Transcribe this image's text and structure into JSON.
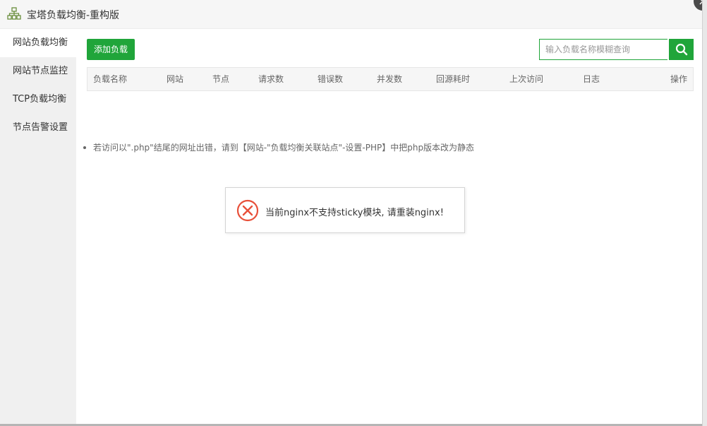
{
  "window": {
    "title": "宝塔负载均衡-重构版",
    "close_symbol": "×"
  },
  "sidebar": {
    "items": [
      {
        "label": "网站负载均衡",
        "active": true
      },
      {
        "label": "网站节点监控",
        "active": false
      },
      {
        "label": "TCP负载均衡",
        "active": false
      },
      {
        "label": "节点告警设置",
        "active": false
      }
    ]
  },
  "toolbar": {
    "add_label": "添加负载",
    "search_placeholder": "输入负载名称模糊查询"
  },
  "table": {
    "columns": [
      "负载名称",
      "网站",
      "节点",
      "请求数",
      "错误数",
      "并发数",
      "回源耗时",
      "上次访问",
      "日志",
      "操作"
    ],
    "rows": []
  },
  "note": "若访问以\".php\"结尾的网址出错，请到【网站-\"负载均衡关联站点\"-设置-PHP】中把php版本改为静态",
  "toast": {
    "message": "当前nginx不支持sticky模块, 请重装nginx!",
    "icon": "error-x-icon"
  },
  "colors": {
    "accent": "#20a53a",
    "error": "#e8503a"
  }
}
